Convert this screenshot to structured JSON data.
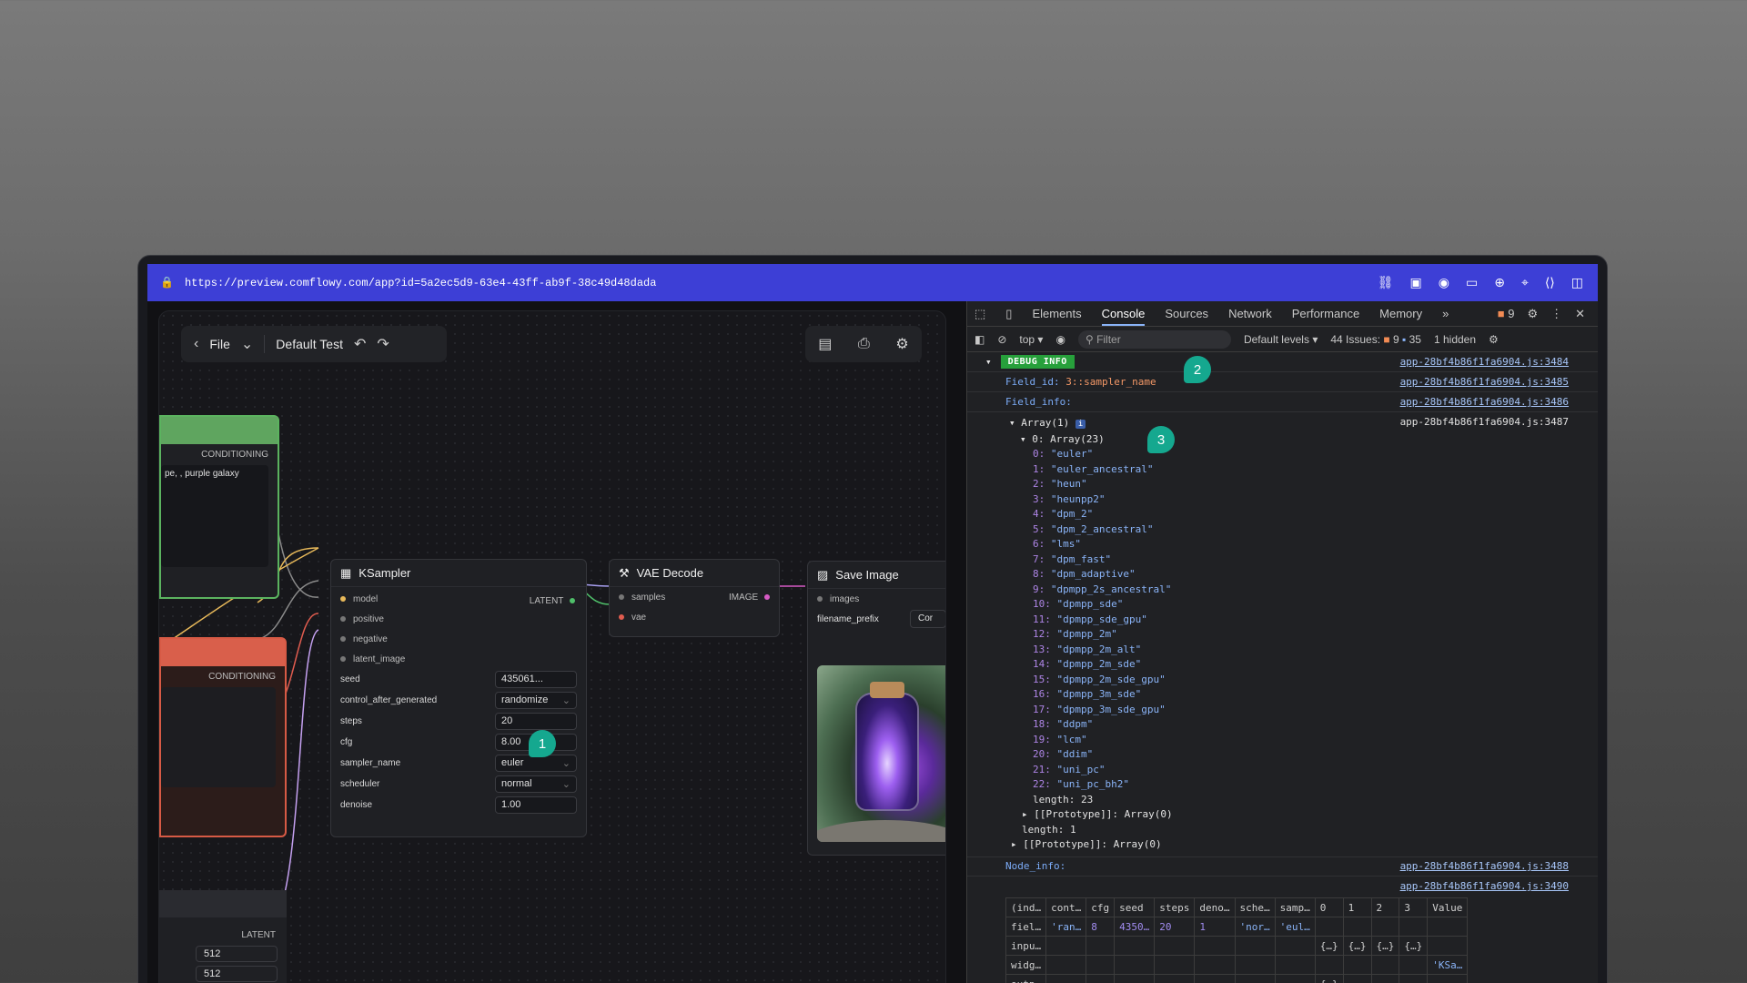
{
  "browser": {
    "url": "https://preview.comflowy.com/app?id=5a2ec5d9-63e4-43ff-ab9f-38c49d48dada"
  },
  "app": {
    "toolbar": {
      "file_label": "File",
      "workflow_name": "Default Test"
    },
    "nodes": {
      "green_out": "CONDITIONING",
      "green_prompt": "pe, , purple galaxy",
      "red_out": "CONDITIONING",
      "latent_out": "LATENT",
      "latent_width": "512",
      "latent_height": "512",
      "ksampler": {
        "title": "KSampler",
        "output": "LATENT",
        "inputs": [
          "model",
          "positive",
          "negative",
          "latent_image"
        ],
        "widgets": [
          {
            "label": "seed",
            "value": "435061..."
          },
          {
            "label": "control_after_generated",
            "value": "randomize"
          },
          {
            "label": "steps",
            "value": "20"
          },
          {
            "label": "cfg",
            "value": "8.00"
          },
          {
            "label": "sampler_name",
            "value": "euler"
          },
          {
            "label": "scheduler",
            "value": "normal"
          },
          {
            "label": "denoise",
            "value": "1.00"
          }
        ]
      },
      "vae": {
        "title": "VAE Decode",
        "in1": "samples",
        "in2": "vae",
        "output": "IMAGE"
      },
      "save": {
        "title": "Save Image",
        "in1": "images",
        "prefix_label": "filename_prefix",
        "prefix_value": "Cor"
      }
    },
    "badges": [
      "1",
      "2",
      "3"
    ]
  },
  "devtools": {
    "tabs": [
      "Elements",
      "Console",
      "Sources",
      "Network",
      "Performance",
      "Memory"
    ],
    "issues_count": "9",
    "filter": {
      "context": "top",
      "placeholder": "Filter",
      "levels": "Default levels",
      "issues": "44 Issues:",
      "warn": "9",
      "info": "35",
      "hidden": "1 hidden"
    },
    "console": {
      "debug_label": "DEBUG INFO",
      "src1": "app-28bf4b86f1fa6904.js:3484",
      "field_id_label": "Field_id:",
      "field_id_value": "3::sampler_name",
      "src2": "app-28bf4b86f1fa6904.js:3485",
      "field_info_label": "Field_info:",
      "src3": "app-28bf4b86f1fa6904.js:3486",
      "array_outer": "Array(1)",
      "src4": "app-28bf4b86f1fa6904.js:3487",
      "array_inner": "0: Array(23)",
      "samplers": [
        "euler",
        "euler_ancestral",
        "heun",
        "heunpp2",
        "dpm_2",
        "dpm_2_ancestral",
        "lms",
        "dpm_fast",
        "dpm_adaptive",
        "dpmpp_2s_ancestral",
        "dpmpp_sde",
        "dpmpp_sde_gpu",
        "dpmpp_2m",
        "dpmpp_2m_alt",
        "dpmpp_2m_sde",
        "dpmpp_2m_sde_gpu",
        "dpmpp_3m_sde",
        "dpmpp_3m_sde_gpu",
        "ddpm",
        "lcm",
        "ddim",
        "uni_pc",
        "uni_pc_bh2"
      ],
      "inner_length": "length: 23",
      "proto_inner": "[[Prototype]]: Array(0)",
      "outer_length": "length: 1",
      "proto_outer": "[[Prototype]]: Array(0)",
      "node_info_label": "Node_info:",
      "src5": "app-28bf4b86f1fa6904.js:3488",
      "src6": "app-28bf4b86f1fa6904.js:3490",
      "table_headers": [
        "(ind…",
        "cont…",
        "cfg",
        "seed",
        "steps",
        "deno…",
        "sche…",
        "samp…",
        "0",
        "1",
        "2",
        "3",
        "Value"
      ],
      "table_rows": [
        [
          "fiel…",
          "'ran…",
          "8",
          "4350…",
          "20",
          "1",
          "'nor…",
          "'eul…",
          "",
          "",
          "",
          "",
          ""
        ],
        [
          "inpu…",
          "",
          "",
          "",
          "",
          "",
          "",
          "",
          "{…}",
          "{…}",
          "{…}",
          "{…}",
          ""
        ],
        [
          "widg…",
          "",
          "",
          "",
          "",
          "",
          "",
          "",
          "",
          "",
          "",
          "",
          "'KSa…"
        ],
        [
          "outp…",
          "",
          "",
          "",
          "",
          "",
          "",
          "",
          "{…}",
          "",
          "",
          "",
          ""
        ]
      ]
    }
  }
}
